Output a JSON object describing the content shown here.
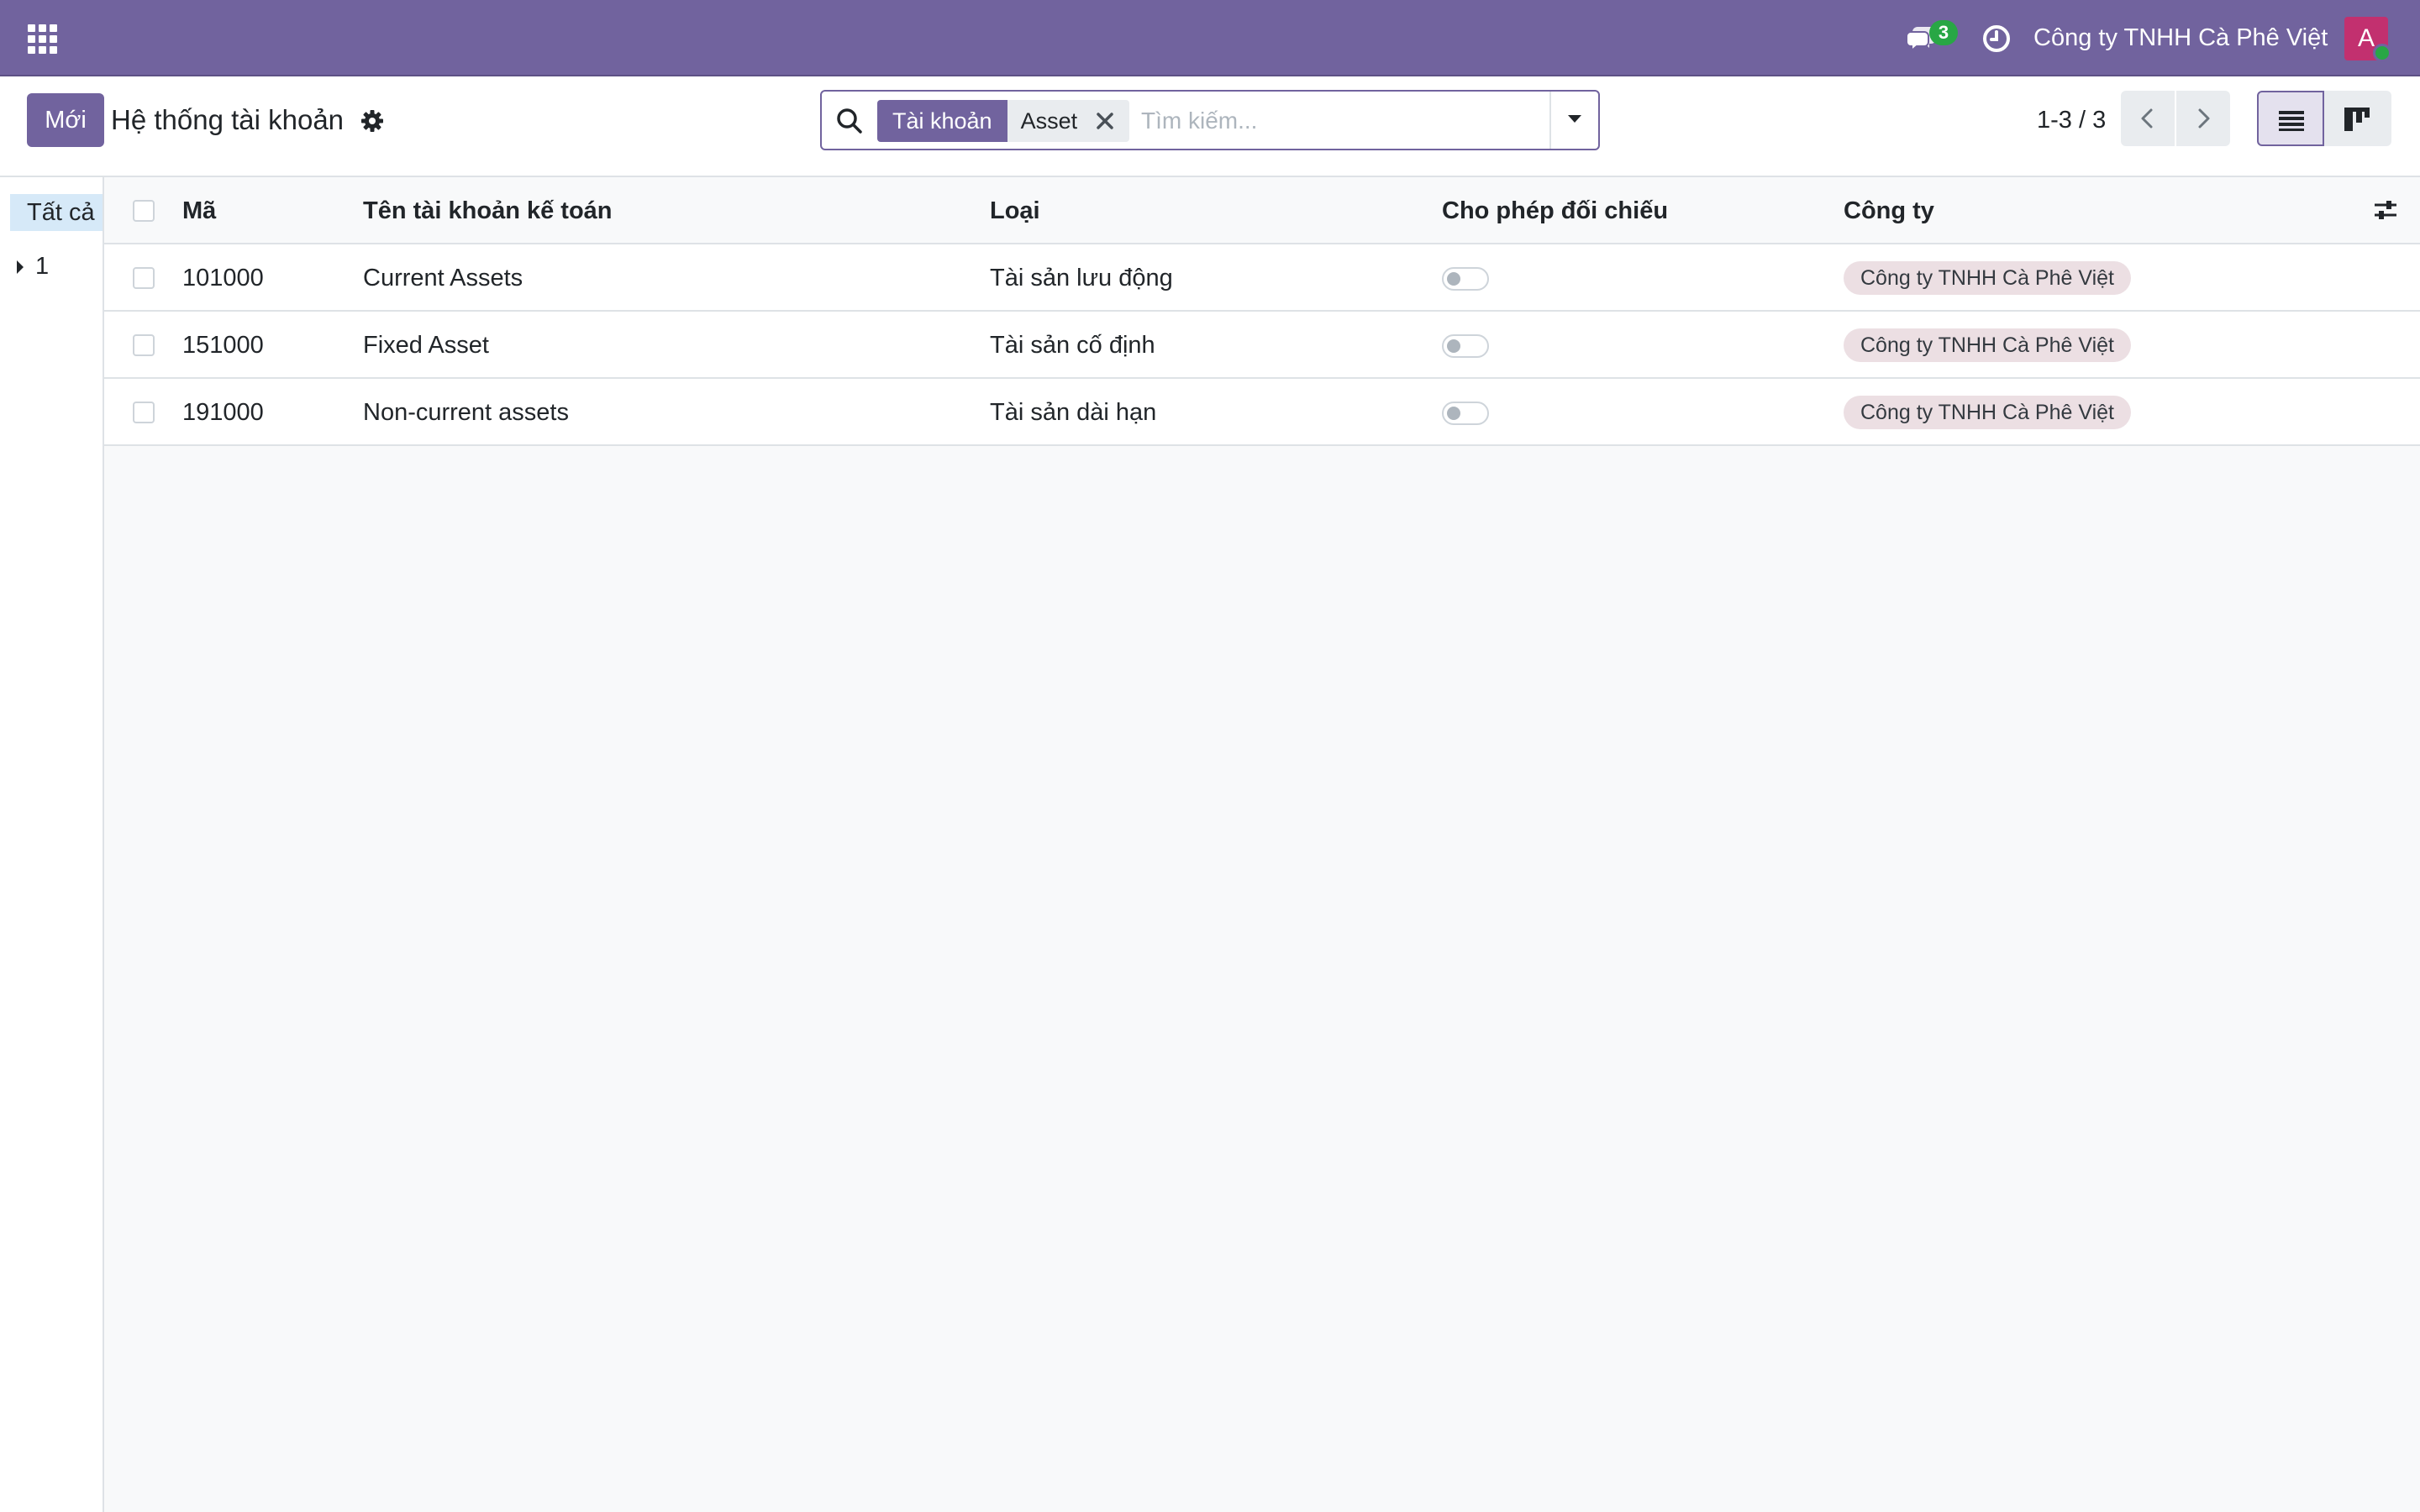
{
  "navbar": {
    "chat_count": "3",
    "company_name": "Công ty TNHH Cà Phê Việt",
    "avatar_initial": "A",
    "bg_color": "#71639e"
  },
  "control_panel": {
    "new_button": "Mới",
    "title": "Hệ thống tài khoản",
    "search": {
      "facet_label": "Tài khoản",
      "facet_value": "Asset",
      "placeholder": "Tìm kiếm..."
    },
    "pager": "1-3 / 3"
  },
  "search_panel": {
    "all_label": "Tất cả",
    "items": [
      {
        "label": "1"
      }
    ]
  },
  "list": {
    "columns": {
      "code": "Mã",
      "name": "Tên tài khoản kế toán",
      "type": "Loại",
      "reconcile": "Cho phép đối chiếu",
      "company": "Công ty"
    },
    "rows": [
      {
        "code": "101000",
        "name": "Current Assets",
        "type": "Tài sản lưu động",
        "reconcile": false,
        "company": "Công ty TNHH Cà Phê Việt"
      },
      {
        "code": "151000",
        "name": "Fixed Asset",
        "type": "Tài sản cố định",
        "reconcile": false,
        "company": "Công ty TNHH Cà Phê Việt"
      },
      {
        "code": "191000",
        "name": "Non-current assets",
        "type": "Tài sản dài hạn",
        "reconcile": false,
        "company": "Công ty TNHH Cà Phê Việt"
      }
    ]
  }
}
